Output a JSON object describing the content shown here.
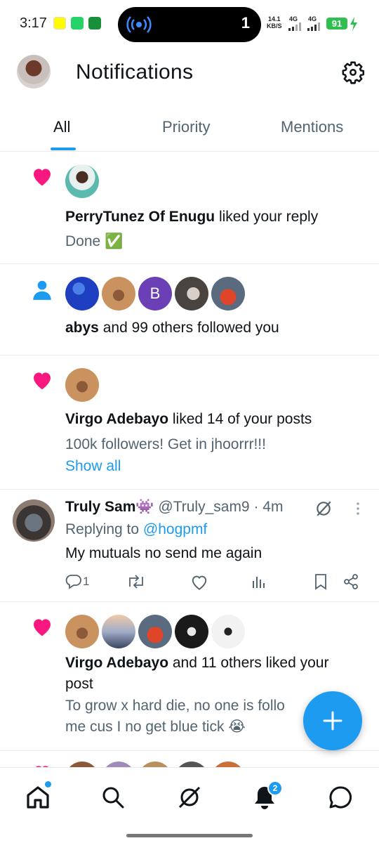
{
  "status_bar": {
    "time": "3:17",
    "island_count": "1",
    "speed_value": "14.1",
    "speed_unit": "KB/S",
    "net1": "4G",
    "net2": "4G",
    "battery": "91"
  },
  "header": {
    "title": "Notifications"
  },
  "tabs": [
    {
      "label": "All",
      "active": true
    },
    {
      "label": "Priority",
      "active": false
    },
    {
      "label": "Mentions",
      "active": false
    }
  ],
  "notifications": [
    {
      "type": "like",
      "actor": "PerryTunez Of Enugu",
      "action": " liked your reply",
      "snippet": "Done ✅"
    },
    {
      "type": "follow",
      "actor": "abys",
      "action": " and 99 others followed you",
      "avatar_letter": "B"
    },
    {
      "type": "like",
      "actor": "Virgo Adebayo",
      "action": " liked 14 of your posts",
      "snippet": "100k followers! Get in jhoorrr!!!",
      "show_all": "Show all"
    },
    {
      "type": "reply",
      "name": "Truly Sam👾",
      "handle": "@Truly_sam9",
      "time": "· 4m",
      "replying_prefix": "Replying to ",
      "replying_handle": "@hogpmf",
      "text": "My mutuals no send me again",
      "reply_count": "1"
    },
    {
      "type": "like",
      "actor": "Virgo Adebayo",
      "action": " and 11 others liked your",
      "action_line2": "post",
      "snippet_line1": "To grow x hard die, no one is follo",
      "snippet_line2": "me cus I no get blue tick 😭"
    }
  ],
  "bottom_nav": {
    "notification_badge": "2"
  },
  "colors": {
    "accent": "#1d9bf0",
    "like": "#f91880",
    "text": "#0f1419",
    "secondary": "#536471"
  }
}
